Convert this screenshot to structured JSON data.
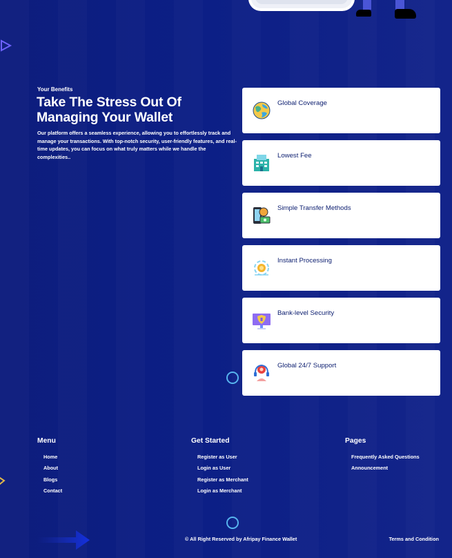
{
  "benefits": {
    "eyebrow": "Your Benefits",
    "title": "Take The Stress Out Of Managing Your Wallet",
    "description": "Our platform offers a seamless experience, allowing you to effortlessly track and manage your transactions. With top-notch security, user-friendly features, and real-time updates, you can focus on what truly matters while we handle the complexities..",
    "cards": [
      {
        "title": "Global Coverage",
        "icon": "globe-icon"
      },
      {
        "title": "Lowest Fee",
        "icon": "building-icon"
      },
      {
        "title": "Simple Transfer Methods",
        "icon": "phone-transfer-icon"
      },
      {
        "title": "Instant Processing",
        "icon": "instant-coin-icon"
      },
      {
        "title": "Bank-level Security",
        "icon": "security-screen-icon"
      },
      {
        "title": "Global 24/7 Support",
        "icon": "support-agent-icon"
      }
    ]
  },
  "footer": {
    "menu": {
      "title": "Menu",
      "items": [
        "Home",
        "About",
        "Blogs",
        "Contact"
      ]
    },
    "get_started": {
      "title": "Get Started",
      "items": [
        "Register as User",
        "Login as User",
        "Register as Merchant",
        "Login as Merchant"
      ]
    },
    "pages": {
      "title": "Pages",
      "items": [
        "Frequently Asked Questions",
        "Announcement"
      ]
    },
    "copyright": "© All Right Reserved by Afripay Finance Wallet",
    "terms": "Terms and Condition"
  },
  "colors": {
    "background": "#0c1f86",
    "card": "#ffffff",
    "card_text": "#0b1d6f",
    "ring": "#57b4ee"
  }
}
